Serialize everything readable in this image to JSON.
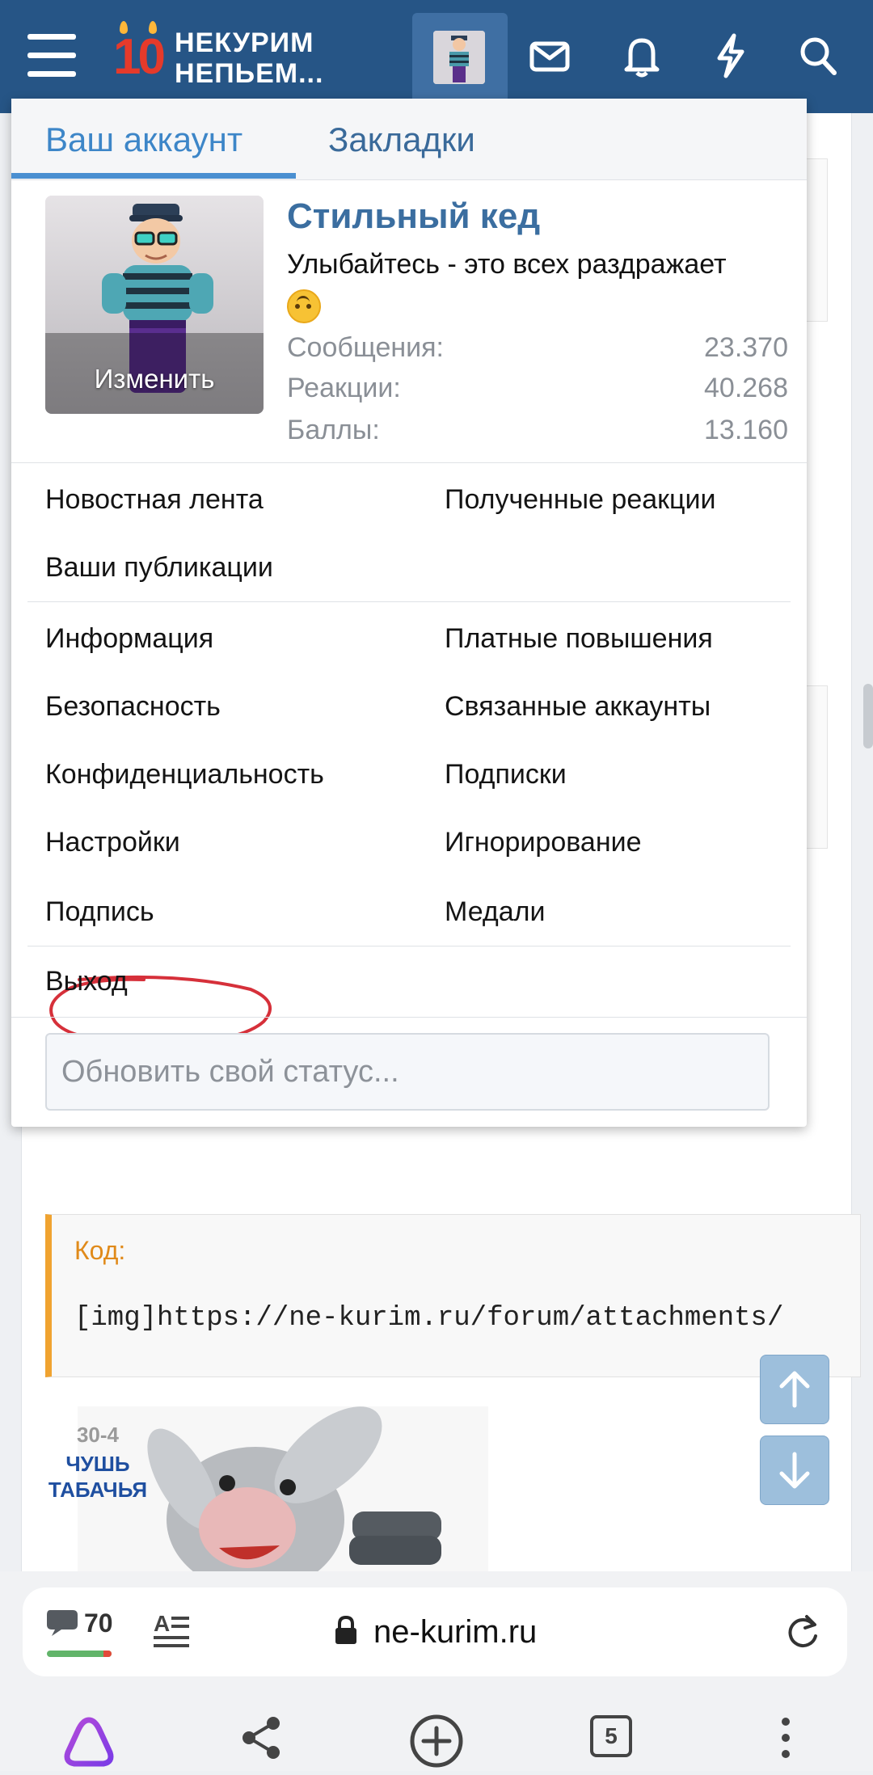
{
  "topbar": {
    "logo_digits": "10",
    "logo_line1": "НЕКУРИМ",
    "logo_line2": "НЕПЬЕМ..."
  },
  "menu": {
    "tabs": [
      {
        "label": "Ваш аккаунт",
        "active": true
      },
      {
        "label": "Закладки",
        "active": false
      }
    ],
    "profile": {
      "username": "Стильный кед",
      "status": "Улыбайтесь - это всех раздражает",
      "avatar_action": "Изменить",
      "stats": [
        {
          "label": "Сообщения:",
          "value": "23.370"
        },
        {
          "label": "Реакции:",
          "value": "40.268"
        },
        {
          "label": "Баллы:",
          "value": "13.160"
        }
      ]
    },
    "links": {
      "news_feed": "Новостная лента",
      "reactions_received": "Полученные реакции",
      "your_content": "Ваши публикации",
      "info": "Информация",
      "paid_upgrades": "Платные повышения",
      "security": "Безопасность",
      "connected_accounts": "Связанные аккаунты",
      "privacy": "Конфиденциальность",
      "subscriptions": "Подписки",
      "preferences": "Настройки",
      "ignoring": "Игнорирование",
      "signature": "Подпись",
      "medals": "Медали",
      "logout": "Выход"
    },
    "status_placeholder": "Обновить свой статус..."
  },
  "page": {
    "code_label": "Код:",
    "code_text": "[img]https://ne-kurim.ru/forum/attachments/",
    "image_caption_top": "30-4",
    "image_caption_1": "ЧУШЬ",
    "image_caption_2": "ТАБАЧЬЯ"
  },
  "browser": {
    "comment_count": "70",
    "url": "ne-kurim.ru",
    "tabs_count": "5"
  },
  "colors": {
    "nav_bg": "#265586",
    "accent": "#3d86c8",
    "username": "#3b6ea0",
    "highlight_circle": "#d6303a",
    "code_border": "#f0a330"
  }
}
